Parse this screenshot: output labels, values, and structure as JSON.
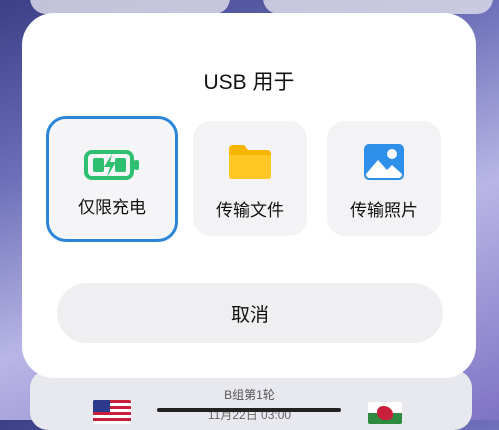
{
  "background": {
    "match_round": "B组第1轮",
    "match_date": "11月22日 03:00"
  },
  "dialog": {
    "title": "USB 用于",
    "options": [
      {
        "label": "仅限充电",
        "icon": "battery-charging-icon",
        "selected": true
      },
      {
        "label": "传输文件",
        "icon": "folder-icon",
        "selected": false
      },
      {
        "label": "传输照片",
        "icon": "photo-icon",
        "selected": false
      }
    ],
    "cancel_label": "取消"
  },
  "colors": {
    "accent": "#2b86d8",
    "battery_green": "#2fbf71",
    "folder_yellow": "#f7b500",
    "photo_blue": "#2e8fe8"
  }
}
